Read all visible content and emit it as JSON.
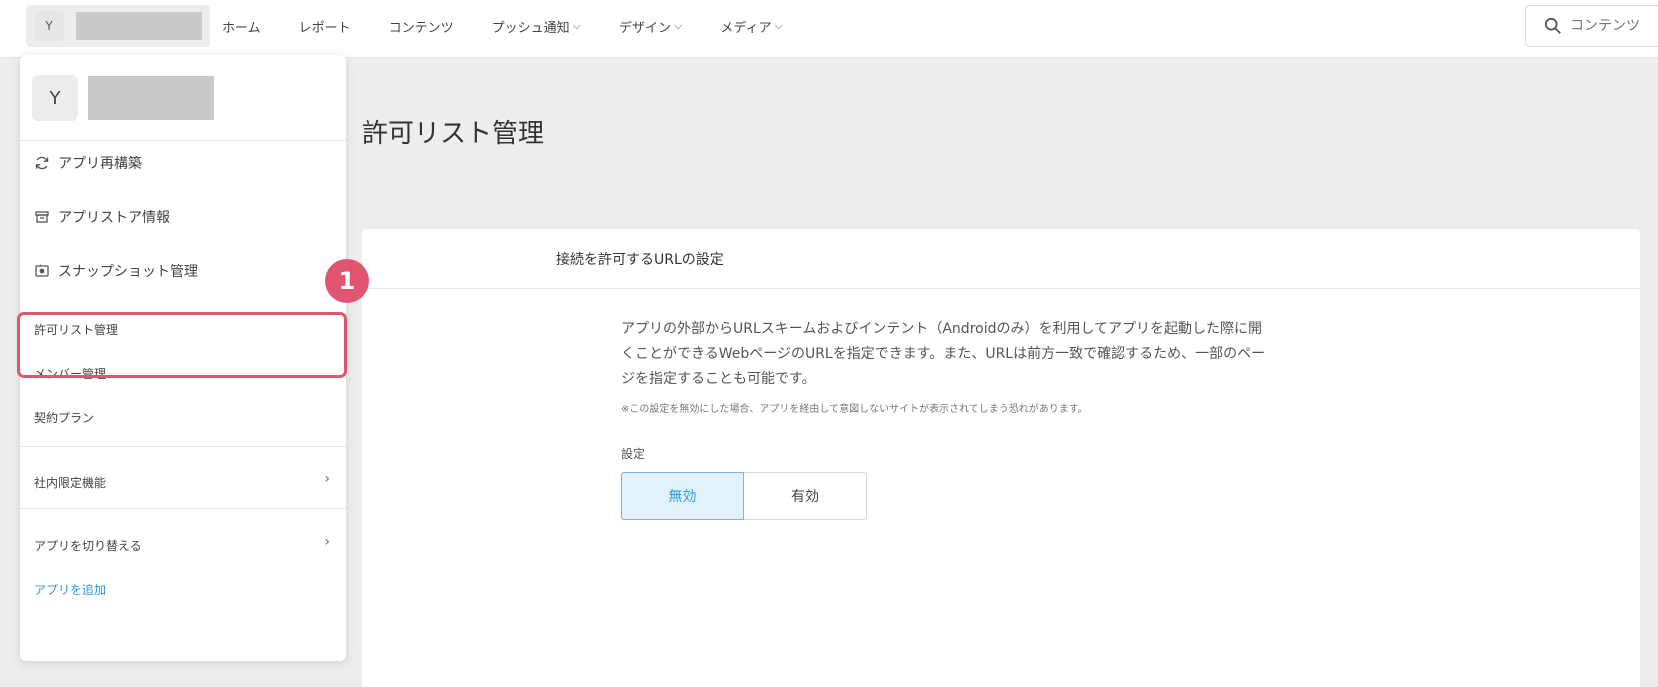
{
  "app": {
    "avatar_letter": "Y"
  },
  "nav": {
    "items": [
      {
        "label": "ホーム",
        "has_chevron": false
      },
      {
        "label": "レポート",
        "has_chevron": false
      },
      {
        "label": "コンテンツ",
        "has_chevron": false
      },
      {
        "label": "プッシュ通知",
        "has_chevron": true
      },
      {
        "label": "デザイン",
        "has_chevron": true
      },
      {
        "label": "メディア",
        "has_chevron": true
      }
    ]
  },
  "search": {
    "placeholder": "コンテンツ"
  },
  "page": {
    "title": "許可リスト管理"
  },
  "card": {
    "header": "接続を許可するURLの設定",
    "description_lines": [
      "アプリの外部からURLスキームおよびインテント（Androidのみ）を利用してアプリを起動した際に開",
      "くことができるWebページのURLを指定できます。また、URLは前方一致で確認するため、一部のペー",
      "ジを指定することも可能です。"
    ],
    "note": "※この設定を無効にした場合、アプリを経由して意図しないサイトが表示されてしまう恐れがあります。",
    "setting_label": "設定",
    "toggle": {
      "off_label": "無効",
      "on_label": "有効",
      "selected": "無効"
    }
  },
  "dropdown": {
    "avatar_letter": "Y",
    "rebuild": "アプリ再構築",
    "store_info": "アプリストア情報",
    "snapshot": "スナップショット管理",
    "allowlist": "許可リスト管理",
    "members": "メンバー管理",
    "plan": "契約プラン",
    "internal": "社内限定機能",
    "switch_app": "アプリを切り替える",
    "add_app": "アプリを追加"
  },
  "annotation": {
    "step_number": "1"
  },
  "colors": {
    "accent": "#2f9ad6",
    "highlight": "#e05670",
    "active_bg": "#e3f1fa"
  }
}
